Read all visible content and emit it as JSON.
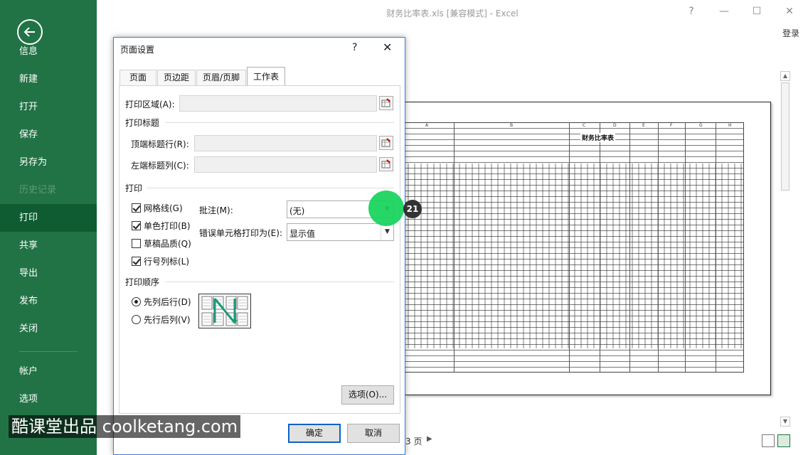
{
  "window": {
    "title": "财务比率表.xls  [兼容模式] - Excel",
    "help": "?",
    "minimize": "—",
    "maximize": "☐",
    "close": "✕",
    "login": "登录"
  },
  "sidebar": {
    "items": [
      {
        "label": "信息"
      },
      {
        "label": "新建"
      },
      {
        "label": "打开"
      },
      {
        "label": "保存"
      },
      {
        "label": "另存为"
      },
      {
        "label": "历史记录"
      },
      {
        "label": "打印"
      },
      {
        "label": "共享"
      },
      {
        "label": "导出"
      },
      {
        "label": "发布"
      },
      {
        "label": "关闭"
      },
      {
        "label": "帐户"
      },
      {
        "label": "选项"
      }
    ]
  },
  "preview": {
    "sheet_title": "财务比率表",
    "columns": [
      "A",
      "B",
      "C",
      "D",
      "E",
      "F",
      "G",
      "H"
    ],
    "page_info": "3 页",
    "next_page": "▶"
  },
  "dialog": {
    "title": "页面设置",
    "help": "?",
    "close": "✕",
    "tabs": [
      {
        "label": "页面"
      },
      {
        "label": "页边距"
      },
      {
        "label": "页眉/页脚"
      },
      {
        "label": "工作表"
      }
    ],
    "active_tab": "工作表",
    "print_area_label": "打印区域(A):",
    "print_titles_group": "打印标题",
    "rows_to_repeat_label": "顶端标题行(R):",
    "cols_to_repeat_label": "左端标题列(C):",
    "print_group": "打印",
    "gridlines_label": "网格线(G)",
    "bw_label": "单色打印(B)",
    "draft_label": "草稿品质(Q)",
    "headings_label": "行号列标(L)",
    "comments_label": "批注(M):",
    "comments_value": "(无)",
    "errors_label": "错误单元格打印为(E):",
    "errors_value": "显示值",
    "order_group": "打印顺序",
    "down_then_over": "先列后行(D)",
    "over_then_down": "先行后列(V)",
    "options_btn": "选项(O)...",
    "ok_btn": "确定",
    "cancel_btn": "取消"
  },
  "overlay": {
    "step": "21",
    "watermark": "酷课堂出品 coolketang.com"
  },
  "colors": {
    "sidebar_bg": "#217346",
    "sidebar_active": "#0f5c33",
    "click_marker": "#14d25a"
  }
}
